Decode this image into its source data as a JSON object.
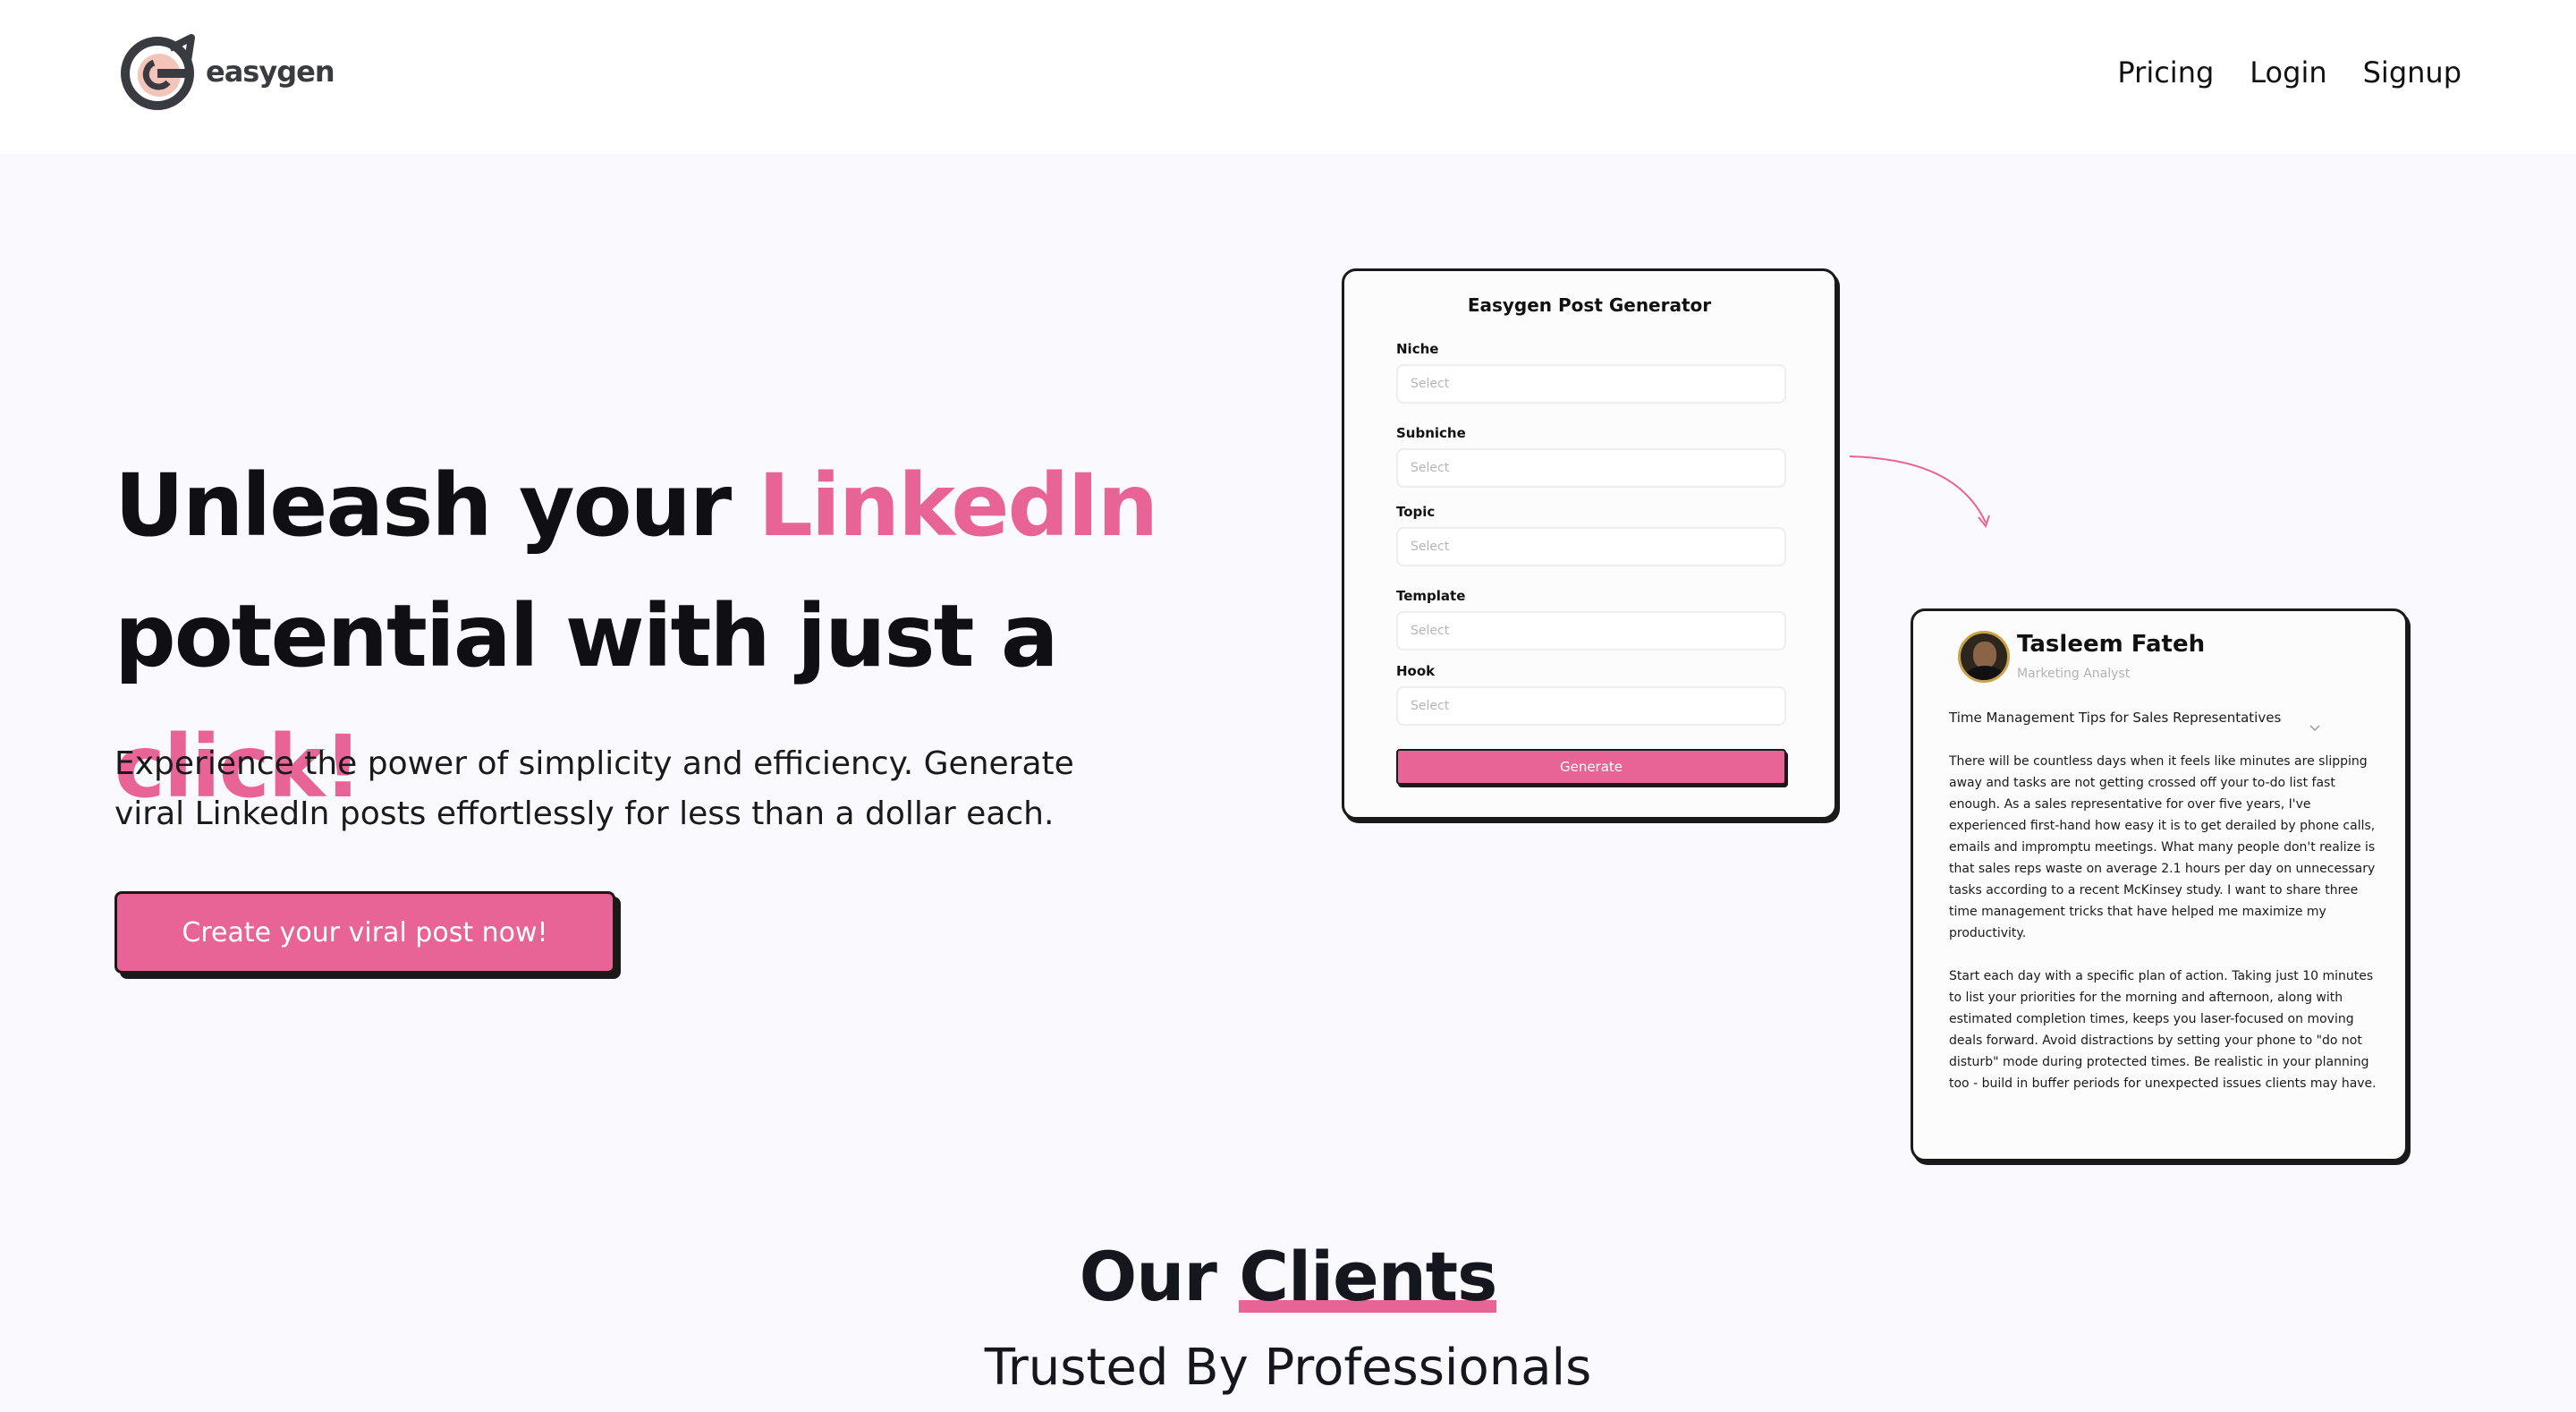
{
  "brand": {
    "name": "easygen",
    "accent": "#e96496",
    "dark": "#1a1a1a"
  },
  "nav": {
    "items": [
      "Pricing",
      "Login",
      "Signup"
    ]
  },
  "hero": {
    "title_part1": "Unleash your ",
    "title_highlight1": "LinkedIn",
    "title_part2": "potential with just a ",
    "title_highlight2": "click!",
    "subtitle": "Experience the power of simplicity and efficiency. Generate viral LinkedIn posts effortlessly for less than a dollar each.",
    "cta_label": "Create your viral post now!"
  },
  "generator": {
    "title": "Easygen Post Generator",
    "fields": [
      {
        "label": "Niche",
        "placeholder": "Select"
      },
      {
        "label": "Subniche",
        "placeholder": "Select"
      },
      {
        "label": "Topic",
        "placeholder": "Select"
      },
      {
        "label": "Template",
        "placeholder": "Select"
      },
      {
        "label": "Hook",
        "placeholder": "Select"
      }
    ],
    "button_label": "Generate"
  },
  "post": {
    "author": "Tasleem Fateh",
    "role": "Marketing Analyst",
    "headline": "Time Management Tips for Sales Representatives",
    "paragraphs": [
      "There will be countless days when it feels like minutes are slipping away and tasks are not getting crossed off your to-do list fast enough. As a sales representative for over five years, I've experienced first-hand how easy it is to get derailed by phone calls, emails and impromptu meetings. What many people don't realize is that sales reps waste on average 2.1 hours per day on unnecessary tasks according to a recent McKinsey study. I want to share three time management tricks that have helped me maximize my productivity.",
      "Start each day with a specific plan of action. Taking just 10 minutes to list your priorities for the morning and afternoon, along with estimated completion times, keeps you laser-focused on moving deals forward. Avoid distractions by setting your phone to \"do not disturb\" mode during protected times. Be realistic in your planning too - build in buffer periods for unexpected issues clients may have."
    ]
  },
  "clients": {
    "title_part1": "Our ",
    "title_highlight": "Clients",
    "subtitle": "Trusted By Professionals"
  }
}
